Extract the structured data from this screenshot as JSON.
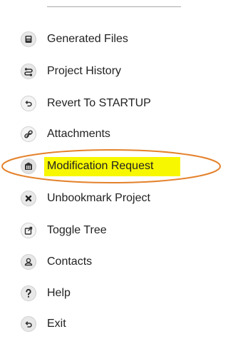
{
  "menu": {
    "items": [
      {
        "label": "Generated Files",
        "icon": "generated-files-icon"
      },
      {
        "label": "Project History",
        "icon": "project-history-icon"
      },
      {
        "label": "Revert To STARTUP",
        "icon": "revert-icon"
      },
      {
        "label": "Attachments",
        "icon": "attachment-icon"
      },
      {
        "label": "Modification Request",
        "icon": "modification-request-icon"
      },
      {
        "label": "Unbookmark Project",
        "icon": "unbookmark-icon"
      },
      {
        "label": "Toggle Tree",
        "icon": "toggle-tree-icon"
      },
      {
        "label": "Contacts",
        "icon": "contacts-icon"
      },
      {
        "label": "Help",
        "icon": "help-icon"
      },
      {
        "label": "Exit",
        "icon": "exit-icon"
      }
    ]
  },
  "annotation": {
    "highlight_color": "#f7f700",
    "ellipse_color": "#e4822c"
  },
  "colors": {
    "icon_fill": "#e8e8e8",
    "icon_stroke": "#444444",
    "text": "#222222"
  }
}
